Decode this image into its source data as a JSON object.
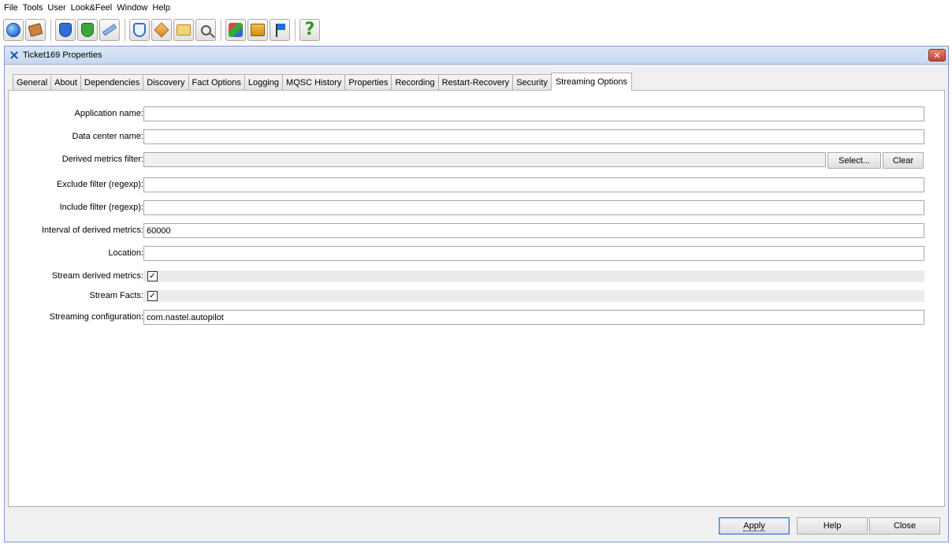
{
  "menu": [
    "File",
    "Tools",
    "User",
    "Look&Feel",
    "Window",
    "Help"
  ],
  "toolbar": {
    "groups": [
      [
        "globe-icon",
        "package-icon"
      ],
      [
        "shield-blue-icon",
        "shield-green-icon",
        "pencil-icon"
      ],
      [
        "shield-outline-icon",
        "box-orange-icon",
        "gear-folder-icon",
        "magnifier-icon"
      ],
      [
        "tool-mix-icon",
        "gift-icon",
        "flag-icon"
      ],
      [
        "help-icon"
      ]
    ]
  },
  "window": {
    "title": "Ticket169 Properties",
    "close_label": "✕"
  },
  "tabs": [
    {
      "label": "General",
      "active": false
    },
    {
      "label": "About",
      "active": false
    },
    {
      "label": "Dependencies",
      "active": false
    },
    {
      "label": "Discovery",
      "active": false
    },
    {
      "label": "Fact Options",
      "active": false
    },
    {
      "label": "Logging",
      "active": false
    },
    {
      "label": "MQSC History",
      "active": false
    },
    {
      "label": "Properties",
      "active": false
    },
    {
      "label": "Recording",
      "active": false
    },
    {
      "label": "Restart-Recovery",
      "active": false
    },
    {
      "label": "Security",
      "active": false
    },
    {
      "label": "Streaming Options",
      "active": true
    }
  ],
  "form": {
    "application_name": {
      "label": "Application name:",
      "value": ""
    },
    "data_center_name": {
      "label": "Data center name:",
      "value": ""
    },
    "derived_metrics_filter": {
      "label": "Derived metrics filter:",
      "value": "",
      "select_label": "Select...",
      "clear_label": "Clear"
    },
    "exclude_filter": {
      "label": "Exclude filter (regexp):",
      "value": ""
    },
    "include_filter": {
      "label": "Include filter (regexp):",
      "value": ""
    },
    "interval_derived": {
      "label": "Interval of derived metrics:",
      "value": "60000"
    },
    "location": {
      "label": "Location:",
      "value": ""
    },
    "stream_derived": {
      "label": "Stream derived metrics:",
      "checked": true,
      "mark": "✓"
    },
    "stream_facts": {
      "label": "Stream Facts:",
      "checked": true,
      "mark": "✓"
    },
    "streaming_config": {
      "label": "Streaming configuration:",
      "value": "com.nastel.autopilot"
    }
  },
  "buttons": {
    "apply": "Apply",
    "help": "Help",
    "close": "Close"
  }
}
